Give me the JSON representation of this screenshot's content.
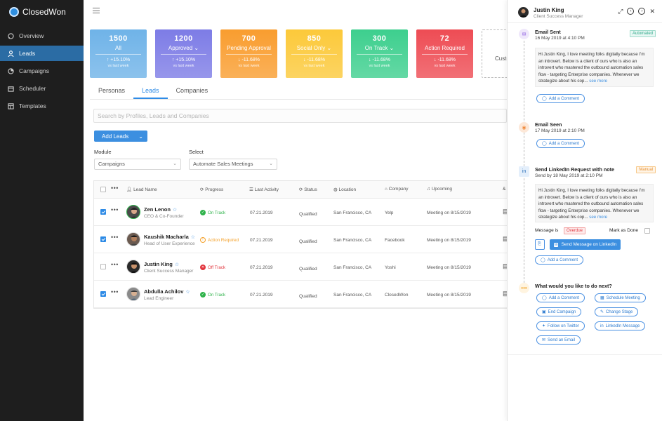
{
  "app": {
    "name": "ClosedWon"
  },
  "sidebar": {
    "items": [
      {
        "label": "Overview",
        "icon": "chat-icon"
      },
      {
        "label": "Leads",
        "icon": "person-icon",
        "active": true
      },
      {
        "label": "Campaigns",
        "icon": "pie-icon"
      },
      {
        "label": "Scheduler",
        "icon": "calendar-icon"
      },
      {
        "label": "Templates",
        "icon": "template-icon"
      }
    ]
  },
  "cards": [
    {
      "value": "1500",
      "label": "All",
      "pct": "+15.10%",
      "dir": "up",
      "sub": "vs last week",
      "color": "#6fb3e8",
      "dropdown": false
    },
    {
      "value": "1200",
      "label": "Approved",
      "pct": "+15.10%",
      "dir": "up",
      "sub": "vs last week",
      "color": "#7d7ce6",
      "dropdown": true
    },
    {
      "value": "700",
      "label": "Pending Approval",
      "pct": "-11.68%",
      "dir": "down",
      "sub": "vs last week",
      "color": "#f99d2f",
      "dropdown": false
    },
    {
      "value": "850",
      "label": "Social Only",
      "pct": "-11.68%",
      "dir": "down",
      "sub": "vs last week",
      "color": "#fcc93a",
      "dropdown": true
    },
    {
      "value": "300",
      "label": "On Track",
      "pct": "-11.68%",
      "dir": "down",
      "sub": "vs last week",
      "color": "#3dcf8e",
      "dropdown": true
    },
    {
      "value": "72",
      "label": "Action Required",
      "pct": "-11.68%",
      "dir": "down",
      "sub": "vs last week",
      "color": "#ee4c54",
      "dropdown": false
    }
  ],
  "custom_card": {
    "label": "Custo"
  },
  "tabs": [
    {
      "label": "Personas"
    },
    {
      "label": "Leads",
      "active": true
    },
    {
      "label": "Companies"
    }
  ],
  "search": {
    "placeholder": "Search by Profiles, Leads and Companies"
  },
  "add_leads": {
    "label": "Add Leads"
  },
  "filters": {
    "module_label": "Module",
    "module_value": "Campaigns",
    "select_label": "Select",
    "select_value": "Automate Sales Meetings"
  },
  "table": {
    "headers": [
      "Lead Name",
      "Progress",
      "Last Activity",
      "Status",
      "Location",
      "Company",
      "Upcoming"
    ],
    "rows": [
      {
        "checked": true,
        "name": "Zen Lenon",
        "role": "CEO & Co-Founder",
        "progress": "On Track",
        "progress_color": "#2fb34b",
        "last_activity": "07.21.2019",
        "status": "Qualified",
        "location": "San Francisco, CA",
        "company": "Yelp",
        "upcoming": "Meeting on 8/15/2019"
      },
      {
        "checked": true,
        "name": "Kaushik Macharla",
        "role": "Head of User Experience",
        "progress": "Action Required",
        "progress_color": "#f4a12a",
        "last_activity": "07.21.2019",
        "status": "Qualified",
        "location": "San Francisco, CA",
        "company": "Facebook",
        "upcoming": "Meeting on 8/15/2019"
      },
      {
        "checked": false,
        "name": "Justin King",
        "role": "Client Success Manager",
        "progress": "Off Track",
        "progress_color": "#e2373f",
        "last_activity": "07.21.2019",
        "status": "Qualified",
        "location": "San Francisco, CA",
        "company": "Yoshi",
        "upcoming": "Meeting on 8/15/2019"
      },
      {
        "checked": true,
        "name": "Abdulla Achilov",
        "role": "Lead Engineer",
        "progress": "On Track",
        "progress_color": "#2fb34b",
        "last_activity": "07.21.2019",
        "status": "Qualified",
        "location": "San Francisco, CA",
        "company": "ClosedWon",
        "upcoming": "Meeting on 8/15/2019"
      }
    ]
  },
  "panel": {
    "name": "Justin King",
    "role": "Client Success Manager",
    "events": [
      {
        "title": "Email Sent",
        "date": "16 May 2019 at 4:10 PM",
        "badge": "Automated",
        "message": "Hi Justin King, I love meeting folks digitally because I'm an introvert. Below is a client of ours who is also an introvert who mastered the outbound automation sales flow - targeting Enterprise companies. Whenever we strategize about his cop...",
        "more": "see more",
        "comment": "Add a Comment"
      },
      {
        "title": "Email Seen",
        "date": "17 May 2019 at 2:10 PM",
        "comment": "Add a Comment"
      },
      {
        "title": "Send LinkedIn Request with note",
        "date": "Send by 18 May 2019 at 2:10 PM",
        "badge": "Manual",
        "message": "Hi Justin King, I love meeting folks digitally because I'm an introvert. Below is a client of ours who is also an introvert who mastered the outbound automation sales flow - targeting Enterprise companies. Whenever we strategize about his cop...",
        "more": "see more",
        "message_is": "Message is",
        "overdue": "Overdue",
        "mark_done": "Mark as Done",
        "send_linkedin": "Send Message on LinkedIn",
        "comment": "Add a Comment"
      }
    ],
    "next": {
      "title": "What would you like to do next?",
      "actions": [
        "Add a Comment",
        "Schedule Meeting",
        "End Campaign",
        "Change Stage",
        "Follow on Twitter",
        "LinkedIn Message",
        "Send an Email"
      ]
    }
  }
}
